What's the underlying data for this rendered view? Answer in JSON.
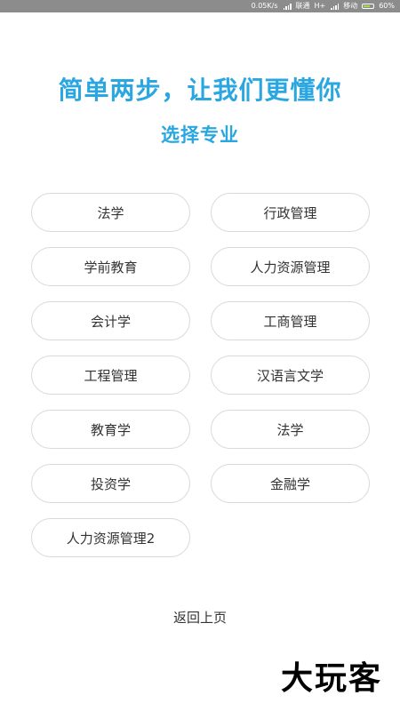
{
  "status_bar": {
    "speed": "0.05K/s",
    "carrier1": "联通",
    "network1": "H+",
    "carrier2": "移动",
    "battery": "60%"
  },
  "header": {
    "title": "简单两步，让我们更懂你",
    "subtitle": "选择专业"
  },
  "majors": [
    {
      "label": "法学"
    },
    {
      "label": "行政管理"
    },
    {
      "label": "学前教育"
    },
    {
      "label": "人力资源管理"
    },
    {
      "label": "会计学"
    },
    {
      "label": "工商管理"
    },
    {
      "label": "工程管理"
    },
    {
      "label": "汉语言文学"
    },
    {
      "label": "教育学"
    },
    {
      "label": "法学"
    },
    {
      "label": "投资学"
    },
    {
      "label": "金融学"
    },
    {
      "label": "人力资源管理2"
    }
  ],
  "footer": {
    "back_label": "返回上页"
  },
  "watermark": {
    "text": "大玩客"
  },
  "colors": {
    "accent": "#2aa7e0",
    "pill_border": "#d9d9d9",
    "status_bar": "#8c8c8c"
  }
}
